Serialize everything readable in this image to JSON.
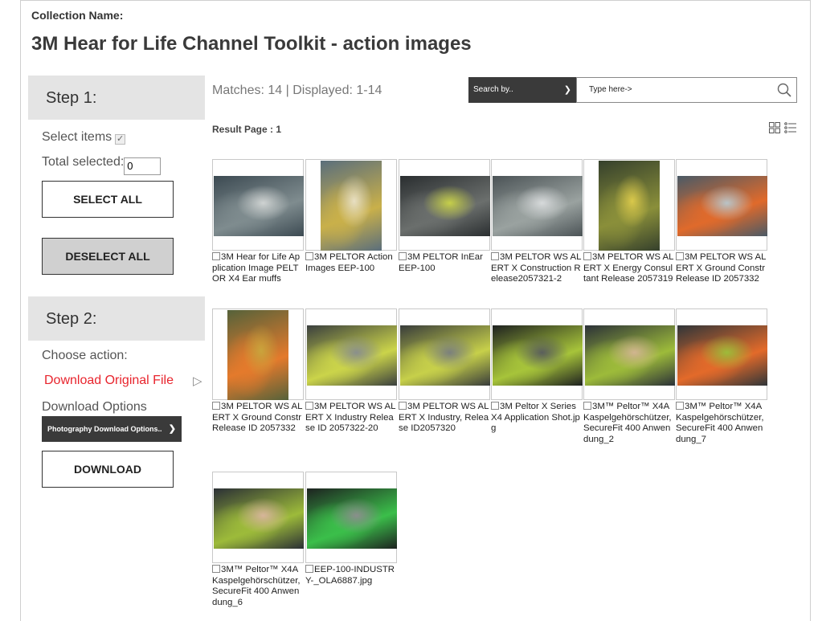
{
  "collection": {
    "label": "Collection Name:",
    "title": "3M Hear for Life Channel Toolkit - action images"
  },
  "sidebar": {
    "step1_label": "Step 1:",
    "select_items_label": "Select items",
    "select_items_mark": "✓",
    "total_selected_label": "Total selected:",
    "total_selected_value": "0",
    "select_all_button": "SELECT ALL",
    "deselect_all_button": "DESELECT ALL",
    "step2_label": "Step 2:",
    "choose_action_label": "Choose action:",
    "download_original_link": "Download Original File",
    "download_original_arrow": "▷",
    "download_options_label": "Download Options",
    "download_options_select": "Photography Download Options..",
    "download_button": "DOWNLOAD"
  },
  "results": {
    "matches_text": "Matches: 14 | Displayed: 1-14",
    "search_by_label": "Search by..",
    "search_placeholder": "Type here->",
    "result_page_label": "Result Page :",
    "result_page_value": "1"
  },
  "items": [
    {
      "caption": "3M Hear for Life Application Image PELTOR X4 Ear muffs",
      "scene": "grinder",
      "colors": [
        "#3c4a52",
        "#7f8c8f",
        "#cfd3d2"
      ]
    },
    {
      "caption": "3M PELTOR Action Images EEP-100",
      "scene": "hardhat",
      "colors": [
        "#5a6e7c",
        "#c9b04a",
        "#e8dfc2"
      ]
    },
    {
      "caption": "3M PELTOR InEar EEP-100",
      "scene": "portrait",
      "colors": [
        "#2a2e30",
        "#6b6f6d",
        "#c6cf4a"
      ]
    },
    {
      "caption": "3M PELTOR WS ALERT X Construction Release2057321-2",
      "scene": "crew",
      "colors": [
        "#4b5356",
        "#9aa2a0",
        "#d7dadb"
      ]
    },
    {
      "caption": "3M PELTOR WS ALERT X Energy Consultant Release 2057319",
      "scene": "energy",
      "colors": [
        "#35402c",
        "#8a8f3a",
        "#d9c84b"
      ]
    },
    {
      "caption": "3M PELTOR WS ALERT X Ground Constr Release ID 2057332",
      "scene": "site",
      "colors": [
        "#4a5a66",
        "#e06a2b",
        "#b9c4c7"
      ]
    },
    {
      "caption": "3M PELTOR WS ALERT X Ground Constr Release ID 2057332",
      "scene": "roller",
      "colors": [
        "#55623a",
        "#e47a2c",
        "#c9a43c"
      ]
    },
    {
      "caption": "3M PELTOR WS ALERT X Industry Release ID 2057322-20",
      "scene": "industry",
      "colors": [
        "#3a3f3e",
        "#cbd44a",
        "#8a8f8c"
      ]
    },
    {
      "caption": "3M PELTOR WS ALERT X Industry, Release ID2057320",
      "scene": "industry2",
      "colors": [
        "#383c3b",
        "#c7d04a",
        "#7b807d"
      ]
    },
    {
      "caption": "3M Peltor X Series X4 Application Shot.jpg",
      "scene": "x4",
      "colors": [
        "#1e2120",
        "#a7c43a",
        "#5a5e5c"
      ]
    },
    {
      "caption": "3M™ Peltor™ X4A Kaspelgehörschützer, SecureFit 400 Anwendung_2",
      "scene": "x4a",
      "colors": [
        "#2b3138",
        "#9dbb3a",
        "#d1b590"
      ]
    },
    {
      "caption": "3M™ Peltor™ X4A Kaspelgehörschützer, SecureFit 400 Anwendung_7",
      "scene": "x4a-orange",
      "colors": [
        "#2f3539",
        "#e36a2a",
        "#9dbb3a"
      ]
    },
    {
      "caption": "3M™ Peltor™ X4A Kaspelgehörschützer, SecureFit 400 Anwendung_6",
      "scene": "x4a-portrait",
      "colors": [
        "#2a2f35",
        "#9dbb3a",
        "#d7b59a"
      ]
    },
    {
      "caption": "EEP-100-INDUSTRY-_OLA6887.jpg",
      "scene": "case",
      "colors": [
        "#1d2220",
        "#3bbf4a",
        "#8a8f8c"
      ]
    }
  ]
}
